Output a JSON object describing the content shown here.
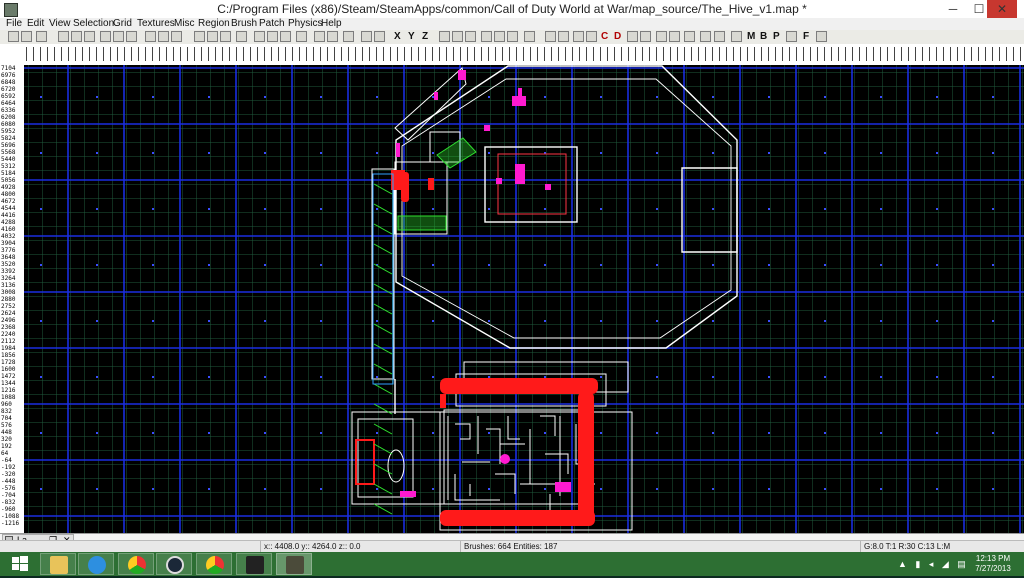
{
  "window": {
    "title": "C:/Program Files (x86)/Steam/SteamApps/common/Call of Duty World at War/map_source/The_Hive_v1.map *",
    "minimize": "─",
    "maximize": "☐",
    "close": "✕"
  },
  "menu": [
    "File",
    "Edit",
    "View",
    "Selection",
    "Grid",
    "Textures",
    "Misc",
    "Region",
    "Brush",
    "Patch",
    "Physics",
    "Help"
  ],
  "toolbar": {
    "x_button": "X",
    "y_button": "Y",
    "z_button": "Z",
    "c_button": "C",
    "d_button": "D",
    "m_button": "M",
    "b_button": "B",
    "p_button": "P",
    "f_button": "F"
  },
  "ruler": {
    "vertical_labels": [
      "7104",
      "6976",
      "6848",
      "6720",
      "6592",
      "6464",
      "6336",
      "6208",
      "6080",
      "5952",
      "5824",
      "5696",
      "5568",
      "5440",
      "5312",
      "5184",
      "5056",
      "4928",
      "4800",
      "4672",
      "4544",
      "4416",
      "4288",
      "4160",
      "4032",
      "3904",
      "3776",
      "3648",
      "3520",
      "3392",
      "3264",
      "3136",
      "3008",
      "2880",
      "2752",
      "2624",
      "2496",
      "2368",
      "2240",
      "2112",
      "1984",
      "1856",
      "1728",
      "1600",
      "1472",
      "1344",
      "1216",
      "1088",
      "960",
      "832",
      "704",
      "576",
      "448",
      "320",
      "192",
      "64",
      "-64",
      "-192",
      "-320",
      "-448",
      "-576",
      "-704",
      "-832",
      "-960",
      "-1088",
      "-1216"
    ]
  },
  "minimized_window": {
    "label": "La..."
  },
  "status": {
    "coords": "x:: 4408.0  y:: 4264.0  z:: 0.0",
    "counts": "Brushes: 664 Entities: 187",
    "grid_info": "G:8.0 T:1 R:30 C:13 L:M"
  },
  "clock": {
    "time": "12:13 PM",
    "date": "7/27/2013"
  },
  "colors": {
    "grid_minor": "#1f5a3d",
    "grid_major": "#1a2ee0",
    "brush": "#ffffff",
    "selection": "#ff1a1a",
    "entity": "#ff1ad0",
    "patch": "#2ee02e",
    "taskbar": "#2d6f33"
  },
  "icons": [
    "application-icon",
    "file-new-icon",
    "file-open-icon",
    "file-save-icon",
    "flip-x-icon",
    "flip-y-icon",
    "flip-z-icon",
    "rotate-x-icon",
    "rotate-y-icon",
    "rotate-z-icon",
    "csg-subtract-icon",
    "csg-merge-icon",
    "clipper-icon",
    "camera-icon",
    "texture-lock-icon",
    "windows-start-icon",
    "file-explorer-icon",
    "internet-explorer-icon",
    "chrome-icon",
    "steam-icon",
    "rocket-icon",
    "radiant-icon"
  ]
}
